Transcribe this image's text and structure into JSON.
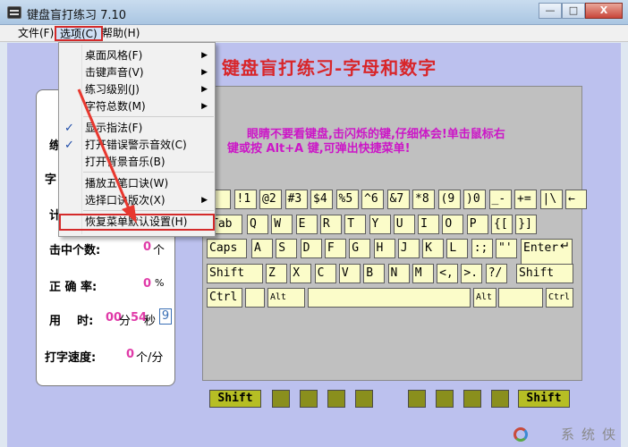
{
  "window": {
    "title": "键盘盲打练习 7.10",
    "min_label": "—",
    "max_label": "□",
    "close_label": "X"
  },
  "menubar": {
    "file": "文件(F)",
    "options": "选项(C)",
    "help": "帮助(H)"
  },
  "dropdown": {
    "items": [
      {
        "label": "桌面风格(F)",
        "submenu": true
      },
      {
        "label": "击键声音(V)",
        "submenu": true
      },
      {
        "label": "练习级别(J)",
        "submenu": true
      },
      {
        "label": "字符总数(M)",
        "submenu": true
      },
      {
        "label": "显示指法(F)",
        "checked": true
      },
      {
        "label": "打开错误警示音效(C)",
        "checked": true
      },
      {
        "label": "打开背景音乐(B)"
      },
      {
        "label": "播放五笔口诀(W)"
      },
      {
        "label": "选择口诀版次(X)",
        "submenu": true
      },
      {
        "label": "恢复菜单默认设置(H)",
        "highlighted": true
      }
    ],
    "submenu_arrow": "▶",
    "check_mark": "✓"
  },
  "app_title": "键盘盲打练习-字母和数字",
  "hint": {
    "line1": "眼睛不要看键盘,击闪烁的键,仔细体会!单击鼠标右",
    "line2": "键或按 Alt+A 键,可弹出快捷菜单!"
  },
  "stats": {
    "row1_label": "练",
    "row2_label": "字",
    "row3_label": "计",
    "hits_label": "击中个数:",
    "hits_value": "0",
    "hits_unit": "个",
    "accuracy_label": "正 确 率:",
    "accuracy_value": "0",
    "accuracy_unit": "%",
    "time_label": "用    时:",
    "time_min_value": "00",
    "time_min_unit": "分",
    "time_sec_value": "54",
    "time_sec_unit": "秒",
    "time_box": "9",
    "speed_label": "打字速度:",
    "speed_value": "0",
    "speed_unit": "个/分"
  },
  "keyboard": {
    "row1": [
      "`",
      "!1",
      "@2",
      "#3",
      "$4",
      "%5",
      "^6",
      "&7",
      "*8",
      "(9",
      ")0",
      "_-",
      "+=",
      "|\\",
      "←"
    ],
    "row2": [
      "Tab",
      "Q",
      "W",
      "E",
      "R",
      "T",
      "Y",
      "U",
      "I",
      "O",
      "P",
      "{[",
      "}]"
    ],
    "row3": [
      "Caps",
      "A",
      "S",
      "D",
      "F",
      "G",
      "H",
      "J",
      "K",
      "L",
      ":;",
      "\"'",
      "Enter"
    ],
    "row4": [
      "Shift",
      "Z",
      "X",
      "C",
      "V",
      "B",
      "N",
      "M",
      "<,",
      ">.",
      "?/",
      "Shift"
    ],
    "row5": [
      "Ctrl",
      "",
      "Alt",
      "",
      "Alt",
      "",
      "Ctrl"
    ],
    "enter_arrow": "↵",
    "bottom_left_shift": "Shift",
    "bottom_right_shift": "Shift"
  },
  "watermark": "系统侠",
  "colors": {
    "accent_red": "#d8262a",
    "hint_magenta": "#cc16c7",
    "key_fill": "#fbfcc9",
    "value_pink": "#e03aa8"
  }
}
